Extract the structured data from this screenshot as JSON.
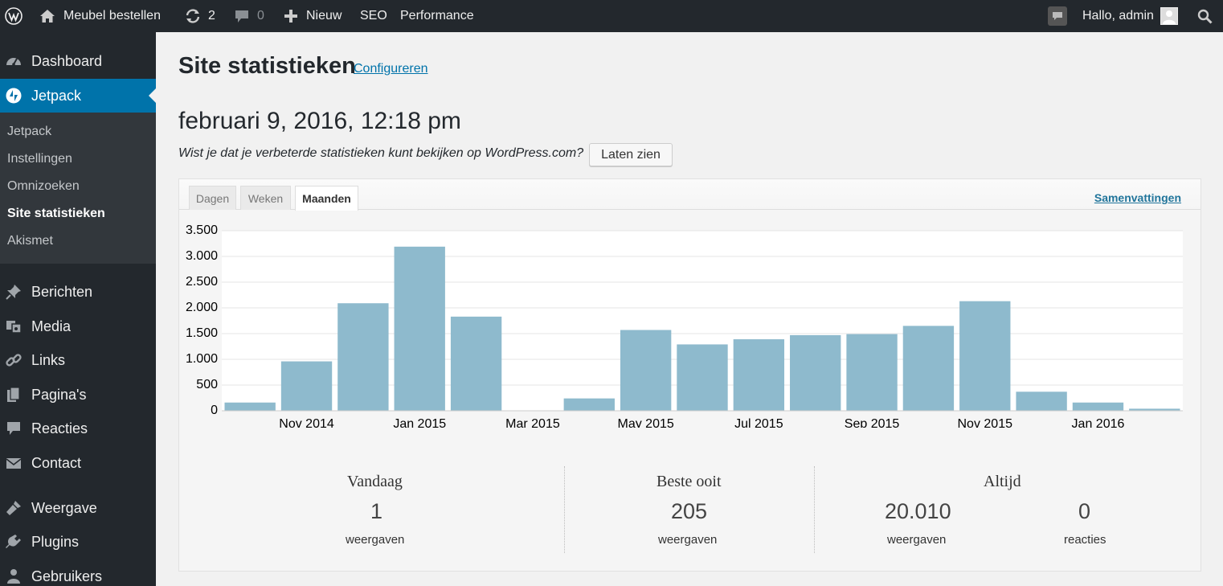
{
  "adminbar": {
    "site_name": "Meubel bestellen",
    "updates_count": "2",
    "comments_count": "0",
    "new_label": "Nieuw",
    "seo_label": "SEO",
    "performance_label": "Performance",
    "greeting": "Hallo, admin"
  },
  "sidebar": {
    "top_items": [
      {
        "label": "Dashboard",
        "icon": "dashboard-icon"
      },
      {
        "label": "Jetpack",
        "icon": "jetpack-icon"
      }
    ],
    "submenu": [
      {
        "label": "Jetpack"
      },
      {
        "label": "Instellingen"
      },
      {
        "label": "Omnizoeken"
      },
      {
        "label": "Site statistieken"
      },
      {
        "label": "Akismet"
      }
    ],
    "items": [
      {
        "label": "Berichten",
        "icon": "pin-icon"
      },
      {
        "label": "Media",
        "icon": "media-icon"
      },
      {
        "label": "Links",
        "icon": "links-icon"
      },
      {
        "label": "Pagina's",
        "icon": "pages-icon"
      },
      {
        "label": "Reacties",
        "icon": "comments-icon"
      },
      {
        "label": "Contact",
        "icon": "mail-icon"
      },
      {
        "label": "Weergave",
        "icon": "appearance-icon"
      },
      {
        "label": "Plugins",
        "icon": "plugins-icon"
      },
      {
        "label": "Gebruikers",
        "icon": "users-icon"
      }
    ]
  },
  "page": {
    "title": "Site statistieken",
    "configure_link": "Configureren",
    "datetime": "februari 9, 2016, 12:18 pm",
    "promo_text": "Wist je dat je verbeterde statistieken kunt bekijken op WordPress.com?",
    "show_button": "Laten zien"
  },
  "tabs": {
    "items": [
      {
        "label": "Dagen"
      },
      {
        "label": "Weken"
      },
      {
        "label": "Maanden"
      }
    ],
    "active": "Maanden",
    "summaries_link": "Samenvattingen"
  },
  "chart_data": {
    "type": "bar",
    "categories": [
      "Okt 2014",
      "Nov 2014",
      "Dec 2014",
      "Jan 2015",
      "Feb 2015",
      "Mar 2015",
      "Apr 2015",
      "May 2015",
      "Jun 2015",
      "Jul 2015",
      "Aug 2015",
      "Sep 2015",
      "Oct 2015",
      "Nov 2015",
      "Dec 2015",
      "Jan 2016",
      "Feb 2016"
    ],
    "values": [
      160,
      960,
      2090,
      3190,
      1830,
      0,
      240,
      1570,
      1290,
      1390,
      1470,
      1490,
      1650,
      2130,
      370,
      160,
      40
    ],
    "x_tick_labels": [
      "Nov 2014",
      "Jan 2015",
      "Mar 2015",
      "May 2015",
      "Jul 2015",
      "Sep 2015",
      "Nov 2015",
      "Jan 2016"
    ],
    "x_tick_positions": [
      1,
      3,
      5,
      7,
      9,
      11,
      13,
      15
    ],
    "y_ticks": [
      0,
      500,
      1000,
      1500,
      2000,
      2500,
      3000,
      3500
    ],
    "y_tick_labels": [
      "0",
      "500",
      "1.000",
      "1.500",
      "2.000",
      "2.500",
      "3.000",
      "3.500"
    ],
    "ylim": [
      0,
      3500
    ],
    "bar_color": "#8ebacd",
    "grid": true
  },
  "summary": {
    "today": {
      "heading": "Vandaag",
      "value": "1",
      "unit": "weergaven"
    },
    "best": {
      "heading": "Beste ooit",
      "value": "205",
      "unit": "weergaven"
    },
    "alltime": {
      "heading": "Altijd",
      "views_value": "20.010",
      "views_unit": "weergaven",
      "comments_value": "0",
      "comments_unit": "reacties"
    }
  }
}
